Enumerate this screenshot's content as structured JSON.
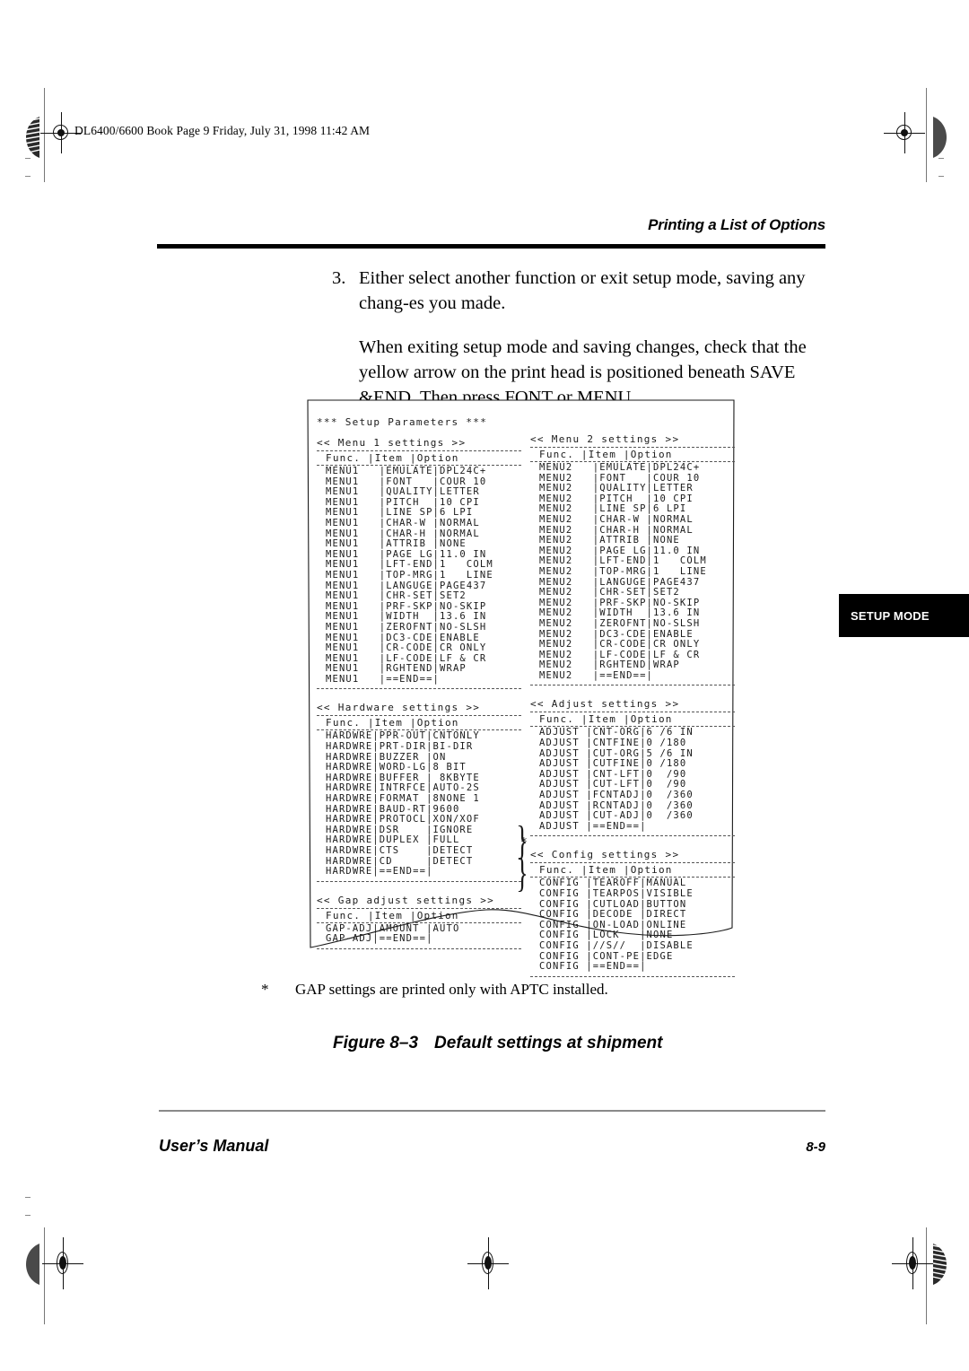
{
  "page": {
    "file_stamp": "DL6400/6600 Book  Page 9  Friday, July 31, 1998  11:42 AM",
    "running_head": "Printing a List of Options",
    "footer_left": "User’s Manual",
    "footer_right": "8-9"
  },
  "body": {
    "step_number": "3.",
    "step_text": "Either select another function or exit setup mode, saving any chang-es you made.",
    "paragraph": "When exiting setup mode and saving changes, check that the yellow arrow on the print head is positioned beneath SAVE &END. Then press FONT or MENU."
  },
  "side_tab": {
    "label": "SETUP MODE"
  },
  "footnote": {
    "marker": "*",
    "text": "GAP settings are printed only with APTC installed."
  },
  "figure": {
    "number": "Figure 8–3",
    "title": "Default settings at shipment"
  },
  "printout": {
    "title": "***  Setup Parameters  ***",
    "column_headers": "Func.   |Item    |Option",
    "sections": [
      {
        "heading": "<< Menu 1 settings >>",
        "header": "Func.   |Item    |Option",
        "rows": [
          "MENU1   |EMULATE|DPL24C+",
          "MENU1   |FONT   |COUR 10",
          "MENU1   |QUALITY|LETTER",
          "MENU1   |PITCH  |10 CPI",
          "MENU1   |LINE SP|6 LPI",
          "MENU1   |CHAR-W |NORMAL",
          "MENU1   |CHAR-H |NORMAL",
          "MENU1   |ATTRIB |NONE",
          "MENU1   |PAGE LG|11.0 IN",
          "MENU1   |LFT-END|1   COLM",
          "MENU1   |TOP-MRG|1   LINE",
          "MENU1   |LANGUGE|PAGE437",
          "MENU1   |CHR-SET|SET2",
          "MENU1   |PRF-SKP|NO-SKIP",
          "MENU1   |WIDTH  |13.6 IN",
          "MENU1   |ZEROFNT|NO-SLSH",
          "MENU1   |DC3-CDE|ENABLE",
          "MENU1   |CR-CODE|CR ONLY",
          "MENU1   |LF-CODE|LF & CR",
          "MENU1   |RGHTEND|WRAP",
          "MENU1   |==END==|"
        ]
      },
      {
        "heading": "<< Hardware settings >>",
        "header": "Func.   |Item    |Option",
        "rows": [
          "HARDWRE|PPR-OUT|CNTONLY",
          "HARDWRE|PRT-DIR|BI-DIR",
          "HARDWRE|BUZZER |ON",
          "HARDWRE|WORD-LG|8 BIT",
          "HARDWRE|BUFFER | 8KBYTE",
          "HARDWRE|INTRFCE|AUTO-2S",
          "HARDWRE|FORMAT |8NONE 1",
          "HARDWRE|BAUD-RT|9600",
          "HARDWRE|PROTOCL|XON/XOF",
          "HARDWRE|DSR    |IGNORE",
          "HARDWRE|DUPLEX |FULL",
          "HARDWRE|CTS    |DETECT",
          "HARDWRE|CD     |DETECT",
          "HARDWRE|==END==|"
        ]
      },
      {
        "heading": "<< Gap adjust settings >>",
        "header": "Func.   |Item    |Option",
        "rows": [
          "GAP-ADJ|AMOUNT |AUTO",
          "GAP-ADJ|==END==|"
        ]
      },
      {
        "heading": "<< Menu 2 settings >>",
        "header": "Func.   |Item    |Option",
        "rows": [
          "MENU2   |EMULATE|DPL24C+",
          "MENU2   |FONT   |COUR 10",
          "MENU2   |QUALITY|LETTER",
          "MENU2   |PITCH  |10 CPI",
          "MENU2   |LINE SP|6 LPI",
          "MENU2   |CHAR-W |NORMAL",
          "MENU2   |CHAR-H |NORMAL",
          "MENU2   |ATTRIB |NONE",
          "MENU2   |PAGE LG|11.0 IN",
          "MENU2   |LFT-END|1   COLM",
          "MENU2   |TOP-MRG|1   LINE",
          "MENU2   |LANGUGE|PAGE437",
          "MENU2   |CHR-SET|SET2",
          "MENU2   |PRF-SKP|NO-SKIP",
          "MENU2   |WIDTH  |13.6 IN",
          "MENU2   |ZEROFNT|NO-SLSH",
          "MENU2   |DC3-CDE|ENABLE",
          "MENU2   |CR-CODE|CR ONLY",
          "MENU2   |LF-CODE|LF & CR",
          "MENU2   |RGHTEND|WRAP",
          "MENU2   |==END==|"
        ]
      },
      {
        "heading": "<< Adjust settings >>",
        "header": "Func.   |Item    |Option",
        "rows": [
          "ADJUST |CNT-ORG|6 /6 IN",
          "ADJUST |CNTFINE|0 /180",
          "ADJUST |CUT-ORG|5 /6 IN",
          "ADJUST |CUTFINE|0 /180",
          "ADJUST |CNT-LFT|0  /90",
          "ADJUST |CUT-LFT|0  /90",
          "ADJUST |FCNTADJ|0  /360",
          "ADJUST |RCNTADJ|0  /360",
          "ADJUST |CUT-ADJ|0  /360",
          "ADJUST |==END==|"
        ]
      },
      {
        "heading": "<< Config settings >>",
        "header": "Func.   |Item    |Option",
        "rows": [
          "CONFIG |TEAROFF|MANUAL",
          "CONFIG |TEARPOS|VISIBLE",
          "CONFIG |CUTLOAD|BUTTON",
          "CONFIG |DECODE |DIRECT",
          "CONFIG |ON-LOAD|ONLINE",
          "CONFIG |LOCK   |NONE",
          "CONFIG |//S//  |DISABLE",
          "CONFIG |CONT-PE|EDGE",
          "CONFIG |==END==|"
        ]
      }
    ],
    "gap_footnote_marker": "*"
  }
}
